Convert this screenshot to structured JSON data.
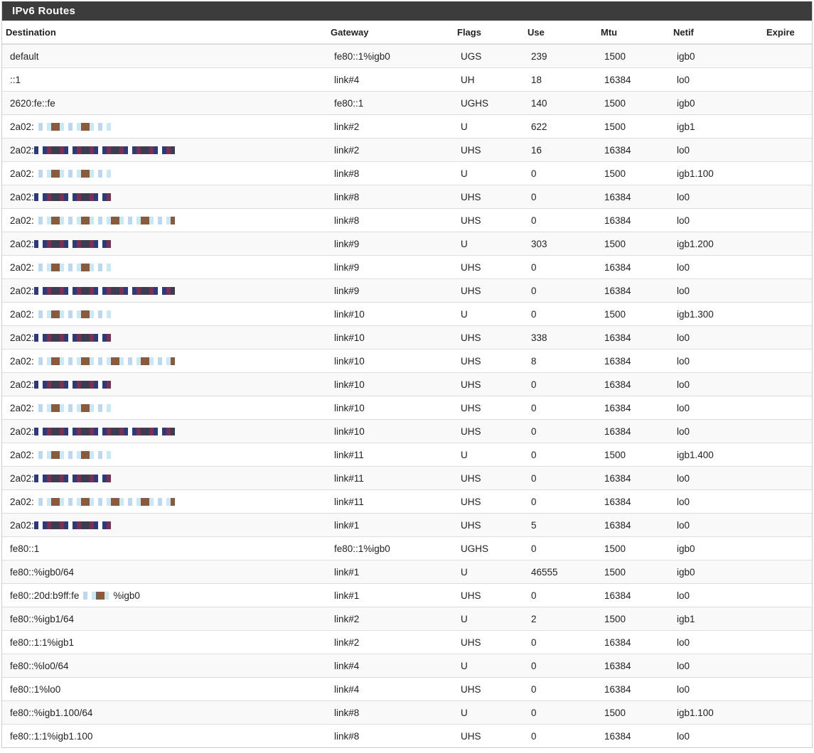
{
  "panel": {
    "title": "IPv6 Routes"
  },
  "columns": [
    "Destination",
    "Gateway",
    "Flags",
    "Use",
    "Mtu",
    "Netif",
    "Expire"
  ],
  "rows": [
    {
      "dest": "default",
      "gw": "fe80::1%igb0",
      "flags": "UGS",
      "use": "239",
      "mtu": "1500",
      "netif": "igb0",
      "expire": ""
    },
    {
      "dest": "::1",
      "gw": "link#4",
      "flags": "UH",
      "use": "18",
      "mtu": "16384",
      "netif": "lo0",
      "expire": ""
    },
    {
      "dest": "2620:fe::fe",
      "gw": "fe80::1",
      "flags": "UGHS",
      "use": "140",
      "mtu": "1500",
      "netif": "igb0",
      "expire": ""
    },
    {
      "dest": "2a02:",
      "redacted": true,
      "gw": "link#2",
      "flags": "U",
      "use": "622",
      "mtu": "1500",
      "netif": "igb1",
      "expire": ""
    },
    {
      "dest": "2a02:",
      "redacted": true,
      "gw": "link#2",
      "flags": "UHS",
      "use": "16",
      "mtu": "16384",
      "netif": "lo0",
      "expire": ""
    },
    {
      "dest": "2a02:",
      "redacted": true,
      "gw": "link#8",
      "flags": "U",
      "use": "0",
      "mtu": "1500",
      "netif": "igb1.100",
      "expire": ""
    },
    {
      "dest": "2a02:",
      "redacted": true,
      "gw": "link#8",
      "flags": "UHS",
      "use": "0",
      "mtu": "16384",
      "netif": "lo0",
      "expire": ""
    },
    {
      "dest": "2a02:",
      "redacted": true,
      "gw": "link#8",
      "flags": "UHS",
      "use": "0",
      "mtu": "16384",
      "netif": "lo0",
      "expire": ""
    },
    {
      "dest": "2a02:",
      "redacted": true,
      "gw": "link#9",
      "flags": "U",
      "use": "303",
      "mtu": "1500",
      "netif": "igb1.200",
      "expire": ""
    },
    {
      "dest": "2a02:",
      "redacted": true,
      "gw": "link#9",
      "flags": "UHS",
      "use": "0",
      "mtu": "16384",
      "netif": "lo0",
      "expire": ""
    },
    {
      "dest": "2a02:",
      "redacted": true,
      "gw": "link#9",
      "flags": "UHS",
      "use": "0",
      "mtu": "16384",
      "netif": "lo0",
      "expire": ""
    },
    {
      "dest": "2a02:",
      "redacted": true,
      "gw": "link#10",
      "flags": "U",
      "use": "0",
      "mtu": "1500",
      "netif": "igb1.300",
      "expire": ""
    },
    {
      "dest": "2a02:",
      "redacted": true,
      "gw": "link#10",
      "flags": "UHS",
      "use": "338",
      "mtu": "16384",
      "netif": "lo0",
      "expire": ""
    },
    {
      "dest": "2a02:",
      "redacted": true,
      "gw": "link#10",
      "flags": "UHS",
      "use": "8",
      "mtu": "16384",
      "netif": "lo0",
      "expire": ""
    },
    {
      "dest": "2a02:",
      "redacted": true,
      "gw": "link#10",
      "flags": "UHS",
      "use": "0",
      "mtu": "16384",
      "netif": "lo0",
      "expire": ""
    },
    {
      "dest": "2a02:",
      "redacted": true,
      "gw": "link#10",
      "flags": "UHS",
      "use": "0",
      "mtu": "16384",
      "netif": "lo0",
      "expire": ""
    },
    {
      "dest": "2a02:",
      "redacted": true,
      "gw": "link#10",
      "flags": "UHS",
      "use": "0",
      "mtu": "16384",
      "netif": "lo0",
      "expire": ""
    },
    {
      "dest": "2a02:",
      "redacted": true,
      "gw": "link#11",
      "flags": "U",
      "use": "0",
      "mtu": "1500",
      "netif": "igb1.400",
      "expire": ""
    },
    {
      "dest": "2a02:",
      "redacted": true,
      "gw": "link#11",
      "flags": "UHS",
      "use": "0",
      "mtu": "16384",
      "netif": "lo0",
      "expire": ""
    },
    {
      "dest": "2a02:",
      "redacted": true,
      "gw": "link#11",
      "flags": "UHS",
      "use": "0",
      "mtu": "16384",
      "netif": "lo0",
      "expire": ""
    },
    {
      "dest": "2a02:",
      "redacted": true,
      "gw": "link#1",
      "flags": "UHS",
      "use": "5",
      "mtu": "16384",
      "netif": "lo0",
      "expire": ""
    },
    {
      "dest": "fe80::1",
      "gw": "fe80::1%igb0",
      "flags": "UGHS",
      "use": "0",
      "mtu": "1500",
      "netif": "igb0",
      "expire": ""
    },
    {
      "dest": "fe80::%igb0/64",
      "gw": "link#1",
      "flags": "U",
      "use": "46555",
      "mtu": "1500",
      "netif": "igb0",
      "expire": ""
    },
    {
      "dest": "fe80::20d:b9ff:fe",
      "redacted": true,
      "dest_suffix": "%igb0",
      "gw": "link#1",
      "flags": "UHS",
      "use": "0",
      "mtu": "16384",
      "netif": "lo0",
      "expire": ""
    },
    {
      "dest": "fe80::%igb1/64",
      "gw": "link#2",
      "flags": "U",
      "use": "2",
      "mtu": "1500",
      "netif": "igb1",
      "expire": ""
    },
    {
      "dest": "fe80::1:1%igb1",
      "gw": "link#2",
      "flags": "UHS",
      "use": "0",
      "mtu": "16384",
      "netif": "lo0",
      "expire": ""
    },
    {
      "dest": "fe80::%lo0/64",
      "gw": "link#4",
      "flags": "U",
      "use": "0",
      "mtu": "16384",
      "netif": "lo0",
      "expire": ""
    },
    {
      "dest": "fe80::1%lo0",
      "gw": "link#4",
      "flags": "UHS",
      "use": "0",
      "mtu": "16384",
      "netif": "lo0",
      "expire": ""
    },
    {
      "dest": "fe80::%igb1.100/64",
      "gw": "link#8",
      "flags": "U",
      "use": "0",
      "mtu": "1500",
      "netif": "igb1.100",
      "expire": ""
    },
    {
      "dest": "fe80::1:1%igb1.100",
      "gw": "link#8",
      "flags": "UHS",
      "use": "0",
      "mtu": "16384",
      "netif": "lo0",
      "expire": ""
    }
  ]
}
